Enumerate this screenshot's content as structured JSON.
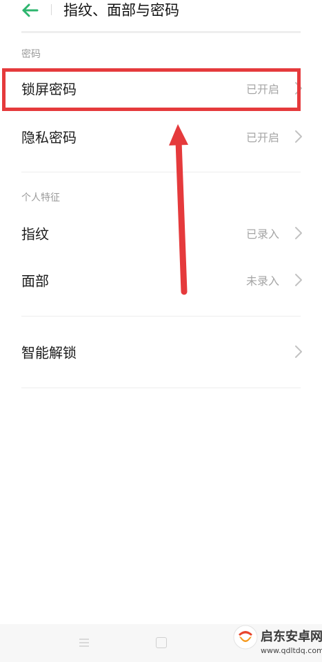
{
  "header": {
    "title": "指纹、面部与密码",
    "back_icon": "arrow-left-icon",
    "accent": "#2db56e"
  },
  "sections": {
    "password": {
      "label": "密码",
      "items": [
        {
          "label": "锁屏密码",
          "value": "已开启"
        },
        {
          "label": "隐私密码",
          "value": "已开启"
        }
      ]
    },
    "personal": {
      "label": "个人特征",
      "items": [
        {
          "label": "指纹",
          "value": "已录入"
        },
        {
          "label": "面部",
          "value": "未录入"
        }
      ]
    },
    "other": {
      "items": [
        {
          "label": "智能解锁"
        }
      ]
    }
  },
  "annotation": {
    "color": "#e53a3c"
  },
  "watermark": {
    "name": "启东安卓网",
    "url": "www.qdltdq.com"
  }
}
